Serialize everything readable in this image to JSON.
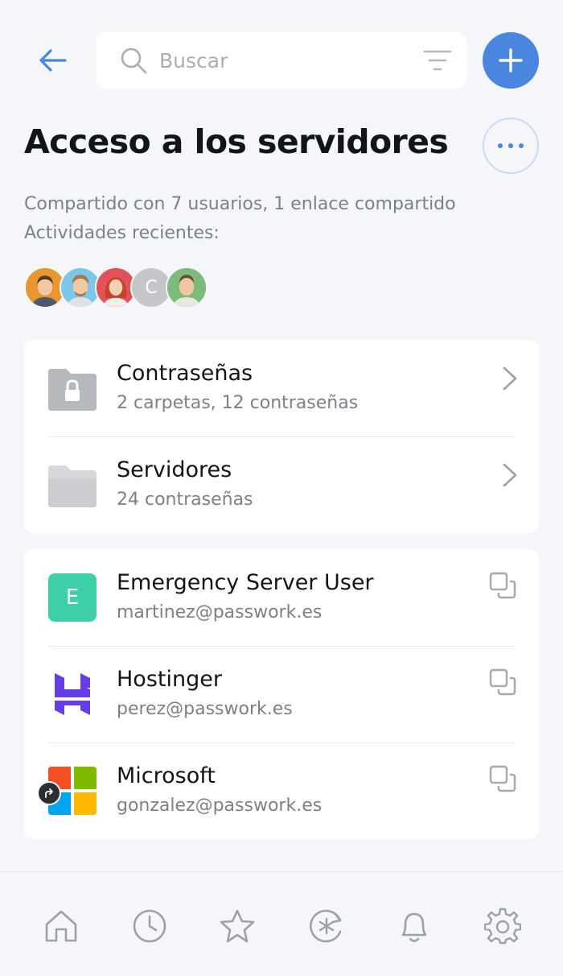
{
  "header": {
    "search_placeholder": "Buscar"
  },
  "vault": {
    "title": "Acceso a los servidores",
    "shared_info": "Compartido con 7 usuarios, 1 enlace compartido",
    "recent_label": "Actividades recientes:",
    "avatars": [
      {
        "type": "photo",
        "bg": "#e8962f",
        "hair": "#5b3a22"
      },
      {
        "type": "photo",
        "bg": "#7cc6e8",
        "hair": "#a8743f"
      },
      {
        "type": "photo",
        "bg": "#e0525a",
        "hair": "#c4432b"
      },
      {
        "type": "letter",
        "letter": "C"
      },
      {
        "type": "photo",
        "bg": "#7dbb7c",
        "hair": "#6b4a2d"
      }
    ]
  },
  "folders": [
    {
      "name": "Contraseñas",
      "sub": "2 carpetas, 12 contraseñas",
      "icon": "locked-folder-icon"
    },
    {
      "name": "Servidores",
      "sub": "24 contraseñas",
      "icon": "folder-icon"
    }
  ],
  "passwords": [
    {
      "name": "Emergency Server User",
      "sub": "martinez@passwork.es",
      "icon": "letter-avatar-icon",
      "letter": "E",
      "color": "#3ecfa6"
    },
    {
      "name": "Hostinger",
      "sub": "perez@passwork.es",
      "icon": "hostinger-logo-icon",
      "color": "#673de6"
    },
    {
      "name": "Microsoft",
      "sub": "gonzalez@passwork.es",
      "icon": "microsoft-logo-icon",
      "shared": true
    }
  ],
  "nav": [
    "home-icon",
    "clock-icon",
    "star-icon",
    "generator-icon",
    "bell-icon",
    "gear-icon"
  ],
  "colors": {
    "accent": "#4a86e0",
    "background": "#f4f6f9",
    "muted_text": "#7c8087"
  }
}
